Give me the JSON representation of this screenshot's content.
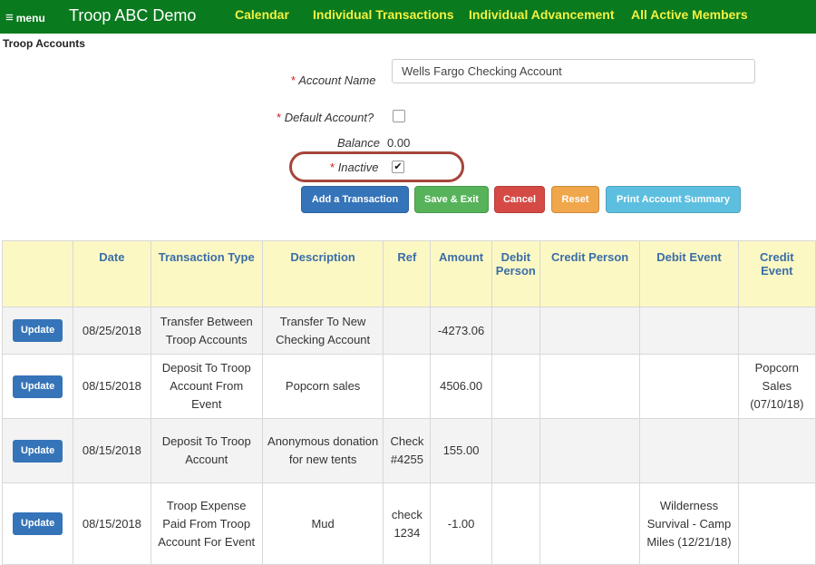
{
  "header": {
    "menu_label": "menu",
    "menu_glyph": "≡",
    "app_title": "Troop ABC Demo",
    "nav": [
      "Calendar",
      "Individual Transactions",
      "Individual Advancement",
      "All Active Members"
    ]
  },
  "page": {
    "section_title": "Troop Accounts"
  },
  "form": {
    "required_mark": "*",
    "account_name_label": "Account Name",
    "account_name_value": "Wells Fargo Checking Account",
    "default_account_label": "Default Account?",
    "default_account_checked": false,
    "balance_label": "Balance",
    "balance_value": "0.00",
    "inactive_label": "Inactive",
    "inactive_checked": true,
    "check_glyph": "✔"
  },
  "actions": {
    "add_transaction": "Add a Transaction",
    "save_exit": "Save & Exit",
    "cancel": "Cancel",
    "reset": "Reset",
    "print_summary": "Print Account Summary"
  },
  "table": {
    "headers": [
      "",
      "Date",
      "Transaction Type",
      "Description",
      "Ref",
      "Amount",
      "Debit Person",
      "Credit Person",
      "Debit Event",
      "Credit Event"
    ],
    "update_label": "Update",
    "rows": [
      {
        "date": "08/25/2018",
        "type": "Transfer Between Troop Accounts",
        "description": "Transfer To New Checking Account",
        "ref": "",
        "amount": "-4273.06",
        "debit_person": "",
        "credit_person": "",
        "debit_event": "",
        "credit_event": ""
      },
      {
        "date": "08/15/2018",
        "type": "Deposit To Troop Account From Event",
        "description": "Popcorn sales",
        "ref": "",
        "amount": "4506.00",
        "debit_person": "",
        "credit_person": "",
        "debit_event": "",
        "credit_event": "Popcorn Sales (07/10/18)"
      },
      {
        "date": "08/15/2018",
        "type": "Deposit To Troop Account",
        "description": "Anonymous donation for new tents",
        "ref": "Check #4255",
        "amount": "155.00",
        "debit_person": "",
        "credit_person": "",
        "debit_event": "",
        "credit_event": ""
      },
      {
        "date": "08/15/2018",
        "type": "Troop Expense Paid From Troop Account For Event",
        "description": "Mud",
        "ref": "check 1234",
        "amount": "-1.00",
        "debit_person": "",
        "credit_person": "",
        "debit_event": "Wilderness Survival - Camp Miles (12/21/18)",
        "credit_event": ""
      }
    ]
  },
  "colors": {
    "topbar": "#0a7a1e",
    "nav_link": "#f2f241",
    "header_bg": "#fcf8c4",
    "header_text": "#3a6ea8",
    "highlight": "#a6453a"
  }
}
